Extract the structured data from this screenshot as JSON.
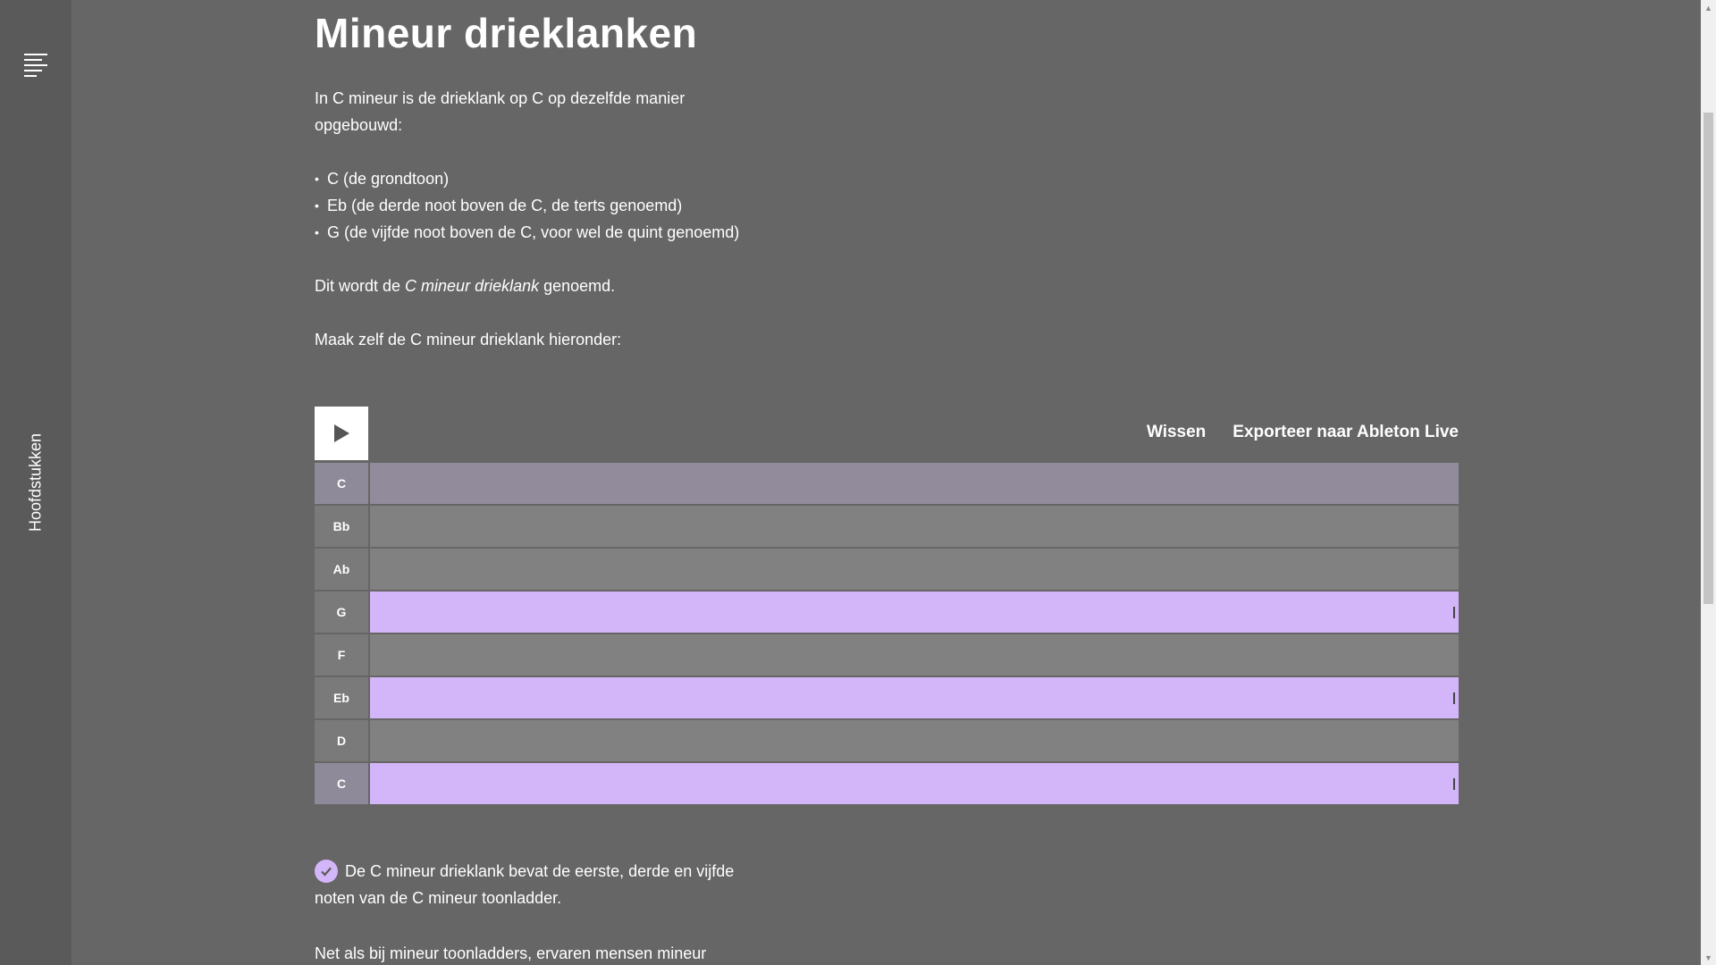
{
  "sidebar": {
    "menu_icon": "menu-lines-icon",
    "label": "Hoofdstukken"
  },
  "main": {
    "title": "Mineur drieklanken",
    "intro_line1": "In C mineur is de drieklank op C op dezelfde manier",
    "intro_line2": "opgebouwd:",
    "bullets": [
      "C (de grondtoon)",
      "Eb (de derde noot boven de C, de terts genoemd)",
      "G (de vijfde noot boven de C, voor wel de quint genoemd)"
    ],
    "named_pre": "Dit wordt de ",
    "named_em": "C mineur drieklank",
    "named_post": " genoemd.",
    "instruction": "Maak zelf de C mineur drieklank hieronder:",
    "result_line1": "De C mineur drieklank bevat de eerste, derde en vijfde",
    "result_line2": "noten van de C mineur toonladder.",
    "next_line": "Net als bij mineur toonladders, ervaren mensen mineur"
  },
  "piano_roll": {
    "play_icon": "play-icon",
    "clear_label": "Wissen",
    "export_label": "Exporteer naar Ableton Live",
    "rows": [
      {
        "note": "C",
        "active": false,
        "root": true
      },
      {
        "note": "Bb",
        "active": false,
        "root": false
      },
      {
        "note": "Ab",
        "active": false,
        "root": false
      },
      {
        "note": "G",
        "active": true,
        "root": false
      },
      {
        "note": "F",
        "active": false,
        "root": false
      },
      {
        "note": "Eb",
        "active": true,
        "root": false
      },
      {
        "note": "D",
        "active": false,
        "root": false
      },
      {
        "note": "C",
        "active": true,
        "root": true
      }
    ]
  },
  "colors": {
    "background": "#666666",
    "sidebar": "#5a5a5a",
    "active_note": "#d3b5fa",
    "lane": "#818181"
  },
  "check_icon": "checkmark-circle-icon"
}
